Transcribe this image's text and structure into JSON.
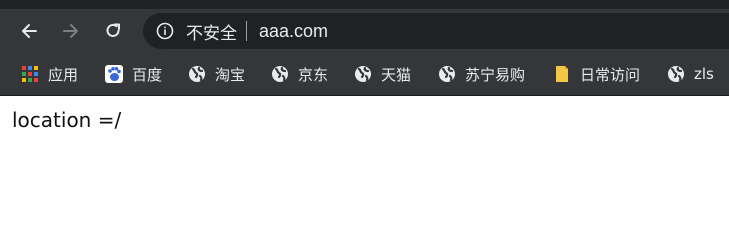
{
  "toolbar": {
    "back_icon": "arrow-left-icon",
    "forward_icon": "arrow-right-icon",
    "reload_icon": "reload-icon",
    "security_label": "不安全",
    "url": "aaa.com"
  },
  "bookmarks": [
    {
      "label": "应用",
      "icon": "apps-grid-icon"
    },
    {
      "label": "百度",
      "icon": "baidu-paw-icon"
    },
    {
      "label": "淘宝",
      "icon": "globe-icon"
    },
    {
      "label": "京东",
      "icon": "globe-icon"
    },
    {
      "label": "天猫",
      "icon": "globe-icon"
    },
    {
      "label": "苏宁易购",
      "icon": "globe-icon"
    },
    {
      "label": "日常访问",
      "icon": "folder-icon"
    },
    {
      "label": "zls",
      "icon": "globe-icon"
    }
  ],
  "page": {
    "body_text": "location =/"
  },
  "colors": {
    "chrome_bg": "#35363a",
    "omnibox_bg": "#202124",
    "text_light": "#e8eaed",
    "folder": "#f2c744",
    "baidu": "#3a66d8"
  }
}
